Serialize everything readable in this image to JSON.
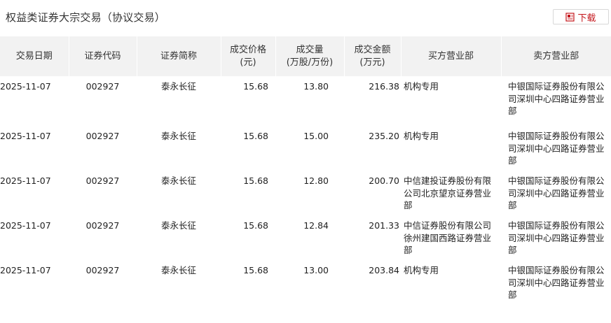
{
  "page": {
    "title": "权益类证券大宗交易（协议交易）",
    "download_label": "下载",
    "download_icon": "download-excel-icon",
    "accent_color": "#c4161c"
  },
  "table": {
    "headers": {
      "date": "交易日期",
      "code": "证券代码",
      "name": "证券简称",
      "price_line1": "成交价格",
      "price_line2": "(元)",
      "volume_line1": "成交量",
      "volume_line2": "(万股/万份)",
      "amount_line1": "成交金额",
      "amount_line2": "(万元)",
      "buyer": "买方营业部",
      "seller": "卖方营业部"
    },
    "rows": [
      {
        "date": "2025-11-07",
        "code": "002927",
        "name": "泰永长征",
        "price": "15.68",
        "volume": "13.80",
        "amount": "216.38",
        "buyer": "机构专用",
        "seller": "中银国际证券股份有限公司深圳中心四路证券营业部"
      },
      {
        "date": "2025-11-07",
        "code": "002927",
        "name": "泰永长征",
        "price": "15.68",
        "volume": "15.00",
        "amount": "235.20",
        "buyer": "机构专用",
        "seller": "中银国际证券股份有限公司深圳中心四路证券营业部"
      },
      {
        "date": "2025-11-07",
        "code": "002927",
        "name": "泰永长征",
        "price": "15.68",
        "volume": "12.80",
        "amount": "200.70",
        "buyer": "中信建投证券股份有限公司北京望京证券营业部",
        "seller": "中银国际证券股份有限公司深圳中心四路证券营业部"
      },
      {
        "date": "2025-11-07",
        "code": "002927",
        "name": "泰永长征",
        "price": "15.68",
        "volume": "12.84",
        "amount": "201.33",
        "buyer": "中信证券股份有限公司徐州建国西路证券营业部",
        "seller": "中银国际证券股份有限公司深圳中心四路证券营业部"
      },
      {
        "date": "2025-11-07",
        "code": "002927",
        "name": "泰永长征",
        "price": "15.68",
        "volume": "13.00",
        "amount": "203.84",
        "buyer": "机构专用",
        "seller": "中银国际证券股份有限公司深圳中心四路证券营业部"
      }
    ]
  }
}
